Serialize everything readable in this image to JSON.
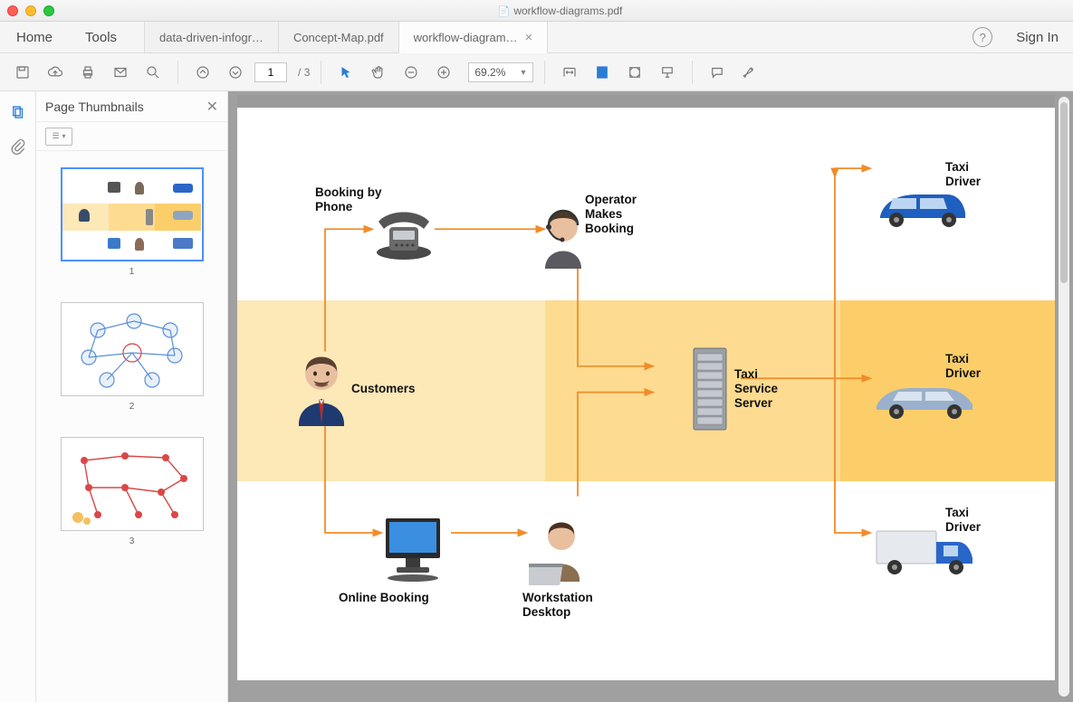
{
  "window": {
    "title": "workflow-diagrams.pdf"
  },
  "menubar": {
    "home": "Home",
    "tools": "Tools",
    "sign_in": "Sign In"
  },
  "tabs": [
    {
      "label": "data-driven-infogr…"
    },
    {
      "label": "Concept-Map.pdf"
    },
    {
      "label": "workflow-diagram…",
      "active": true
    }
  ],
  "toolbar": {
    "page_current": "1",
    "page_sep": "/",
    "page_total": "3",
    "zoom": "69.2%"
  },
  "thumbnails": {
    "title": "Page Thumbnails",
    "pages": [
      {
        "num": "1",
        "selected": true
      },
      {
        "num": "2",
        "selected": false
      },
      {
        "num": "3",
        "selected": false
      }
    ]
  },
  "diagram": {
    "nodes": {
      "booking_phone": "Booking by\nPhone",
      "operator": "Operator\nMakes\nBooking",
      "taxi_driver_top": "Taxi\nDriver",
      "customers": "Customers",
      "taxi_service_server": "Taxi\nService\nServer",
      "taxi_driver_mid": "Taxi\nDriver",
      "online_booking": "Online Booking",
      "workstation": "Workstation\nDesktop",
      "taxi_driver_bot": "Taxi\nDriver"
    }
  }
}
